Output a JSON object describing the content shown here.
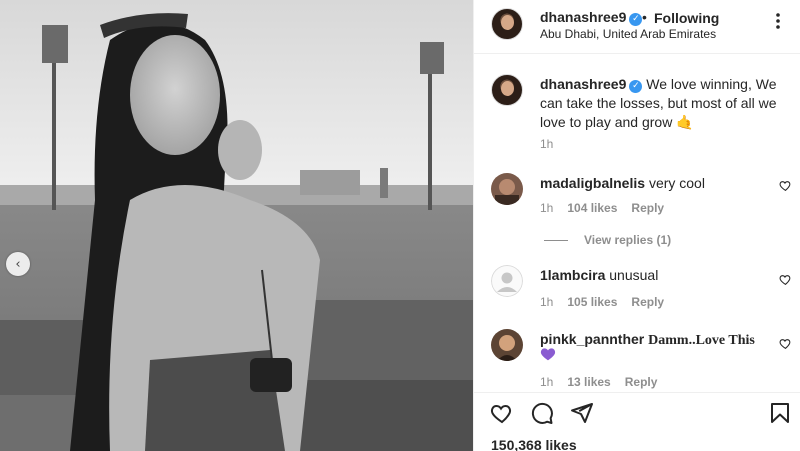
{
  "post": {
    "username": "dhanashree9",
    "verified_glyph": "✓",
    "separator": "•",
    "follow_status": "Following",
    "location": "Abu Dhabi, United Arab Emirates",
    "caption": {
      "username": "dhanashree9",
      "text": "We love winning, We can take the losses, but most of all we love to play and grow",
      "emoji": "🤙",
      "time": "1h"
    },
    "likes": "150,368 likes"
  },
  "comments": [
    {
      "username": "madaligbalnelis",
      "text": "very cool",
      "time": "1h",
      "likes": "104 likes",
      "reply": "Reply",
      "view_replies": "View replies (1)"
    },
    {
      "username": "1lambcira",
      "text": "unusual",
      "time": "1h",
      "likes": "105 likes",
      "reply": "Reply"
    },
    {
      "username": "pinkk_pannther",
      "text": "Damm..Love This",
      "time": "1h",
      "likes": "13 likes",
      "reply": "Reply"
    }
  ],
  "icons": {
    "more": "more-options-icon",
    "like": "heart-icon",
    "comment": "comment-icon",
    "share": "share-icon",
    "save": "bookmark-icon",
    "carousel_prev": "chevron-left-icon"
  },
  "colors": {
    "verified": "#3897f0",
    "secondary_text": "#8e8e8e",
    "purple_heart": "#8a5cd1"
  },
  "carousel": {
    "prev_glyph": "‹"
  }
}
